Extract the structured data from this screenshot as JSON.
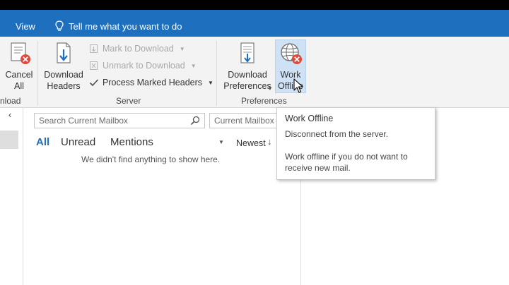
{
  "header": {
    "tab_view": "View",
    "tell_me": "Tell me what you want to do"
  },
  "ribbon": {
    "cancel_all": "Cancel\nAll",
    "partial_group_label": "nload",
    "download_headers": "Download\nHeaders",
    "mark_to_download": "Mark to Download",
    "unmark_to_download": "Unmark to Download",
    "process_marked_headers": "Process Marked Headers",
    "group_server": "Server",
    "download_preferences": "Download\nPreferences",
    "work_offline": "Work\nOffline",
    "group_preferences": "Preferences"
  },
  "search": {
    "placeholder": "Search Current Mailbox",
    "scope": "Current Mailbox"
  },
  "mail_list": {
    "filters": [
      "All",
      "Unread",
      "Mentions"
    ],
    "sort": "Newest",
    "sort_arrow": "↓",
    "empty_message": "We didn't find anything to show here."
  },
  "tooltip": {
    "title": "Work Offline",
    "line1": "Disconnect from the server.",
    "description": "Work offline if you do not want to receive new mail."
  },
  "colors": {
    "accent": "#1e6fbd",
    "ribbon_bg": "#f3f3f3",
    "highlight": "#cfe2f5",
    "error_red": "#e04a3b"
  }
}
